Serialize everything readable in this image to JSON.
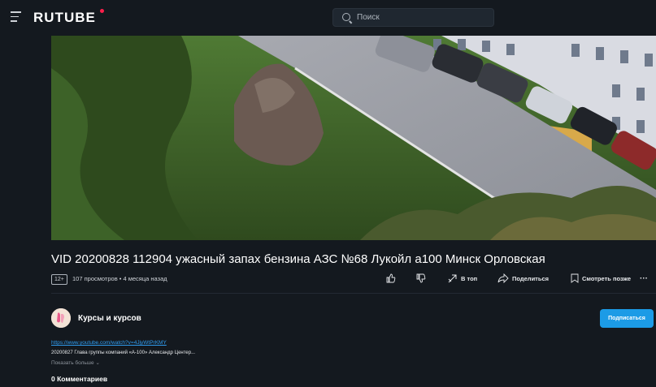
{
  "header": {
    "logo": "RUTUBE",
    "search_placeholder": "Поиск"
  },
  "video": {
    "title": "VID 20200828 112904 ужасный запах бензина АЗС №68 Лукойл а100 Минск Орловская",
    "age_rating": "12+",
    "meta": "107 просмотров • 4 месяца назад"
  },
  "actions": {
    "to_top": "В топ",
    "share": "Поделиться",
    "watch_later": "Смотреть позже",
    "more": "···"
  },
  "channel": {
    "name": "Курсы и курсов",
    "subscribe": "Подписаться"
  },
  "description": {
    "link": "https://www.youtube.com/watch?v=4JjyWtPrKMY",
    "text": "20200827 Глава группы компаний «А-100» Александр Центер...",
    "show_more": "Показать больше ⌄"
  },
  "comments": {
    "count_label": "0 Комментариев"
  },
  "colors": {
    "background": "#14191f",
    "accent": "#1c9be6",
    "logo_dot": "#ff1f4b",
    "link": "#2f9cf0"
  },
  "icons": [
    "menu-icon",
    "search-icon",
    "like-icon",
    "dislike-icon",
    "top-icon",
    "share-icon",
    "bookmark-icon",
    "more-icon"
  ]
}
